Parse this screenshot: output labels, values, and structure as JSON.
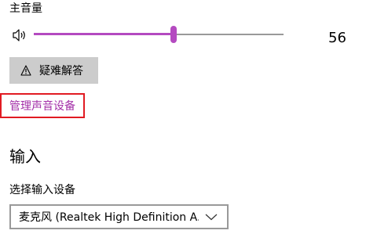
{
  "master_volume": {
    "label": "主音量",
    "icon": "speaker-icon",
    "value": 56,
    "value_text": "56",
    "accent_color": "#b44ac0"
  },
  "troubleshoot": {
    "icon": "warning-icon",
    "label": "疑难解答"
  },
  "manage_devices": {
    "label": "管理声音设备",
    "link_color": "#a32fa8",
    "highlight_color": "#e11b22"
  },
  "input": {
    "heading": "输入",
    "device_label": "选择输入设备",
    "selected_device": "麦克风 (Realtek High Definition A...",
    "dropdown_icon": "chevron-down-icon"
  }
}
